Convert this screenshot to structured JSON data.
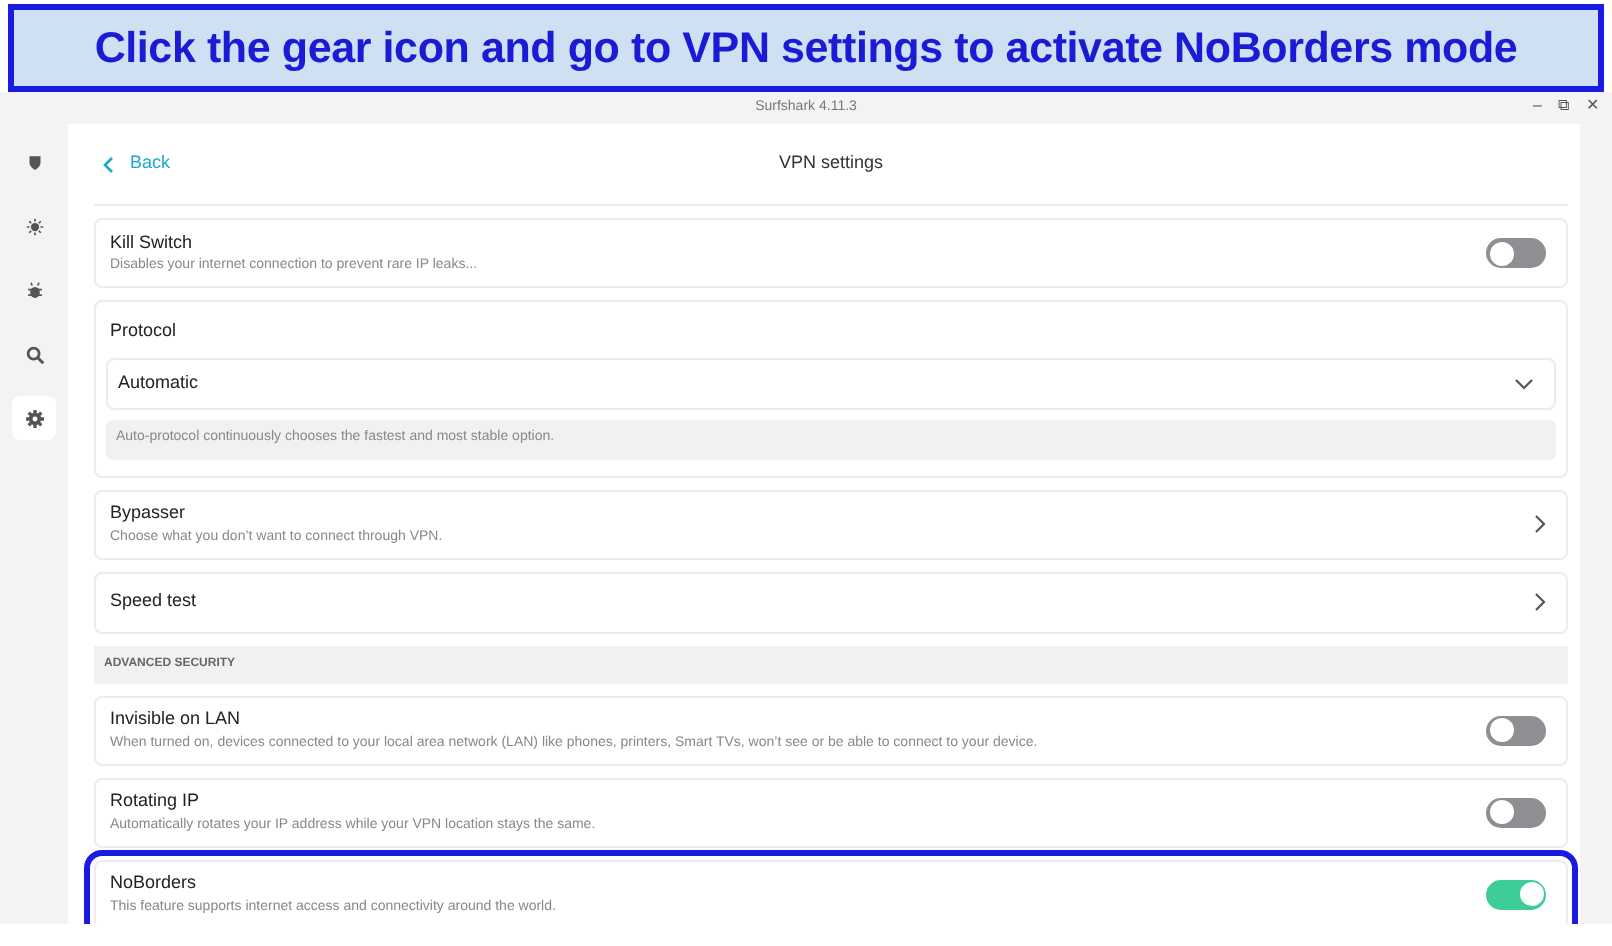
{
  "banner": {
    "text": "Click the gear icon and go to VPN settings to activate NoBorders mode"
  },
  "window": {
    "title": "Surfshark 4.11.3",
    "controls": [
      "–",
      "⧉",
      "✕"
    ]
  },
  "sidebar": {
    "items": [
      {
        "selected": false
      },
      {
        "selected": false
      },
      {
        "selected": false
      },
      {
        "selected": false
      },
      {
        "selected": true
      }
    ]
  },
  "header": {
    "back": "Back",
    "title": "VPN settings"
  },
  "settings": [
    {
      "kind": "toggle",
      "title": "Kill Switch",
      "description": "Disables your internet connection to prevent rare IP leaks...",
      "on": false,
      "highlighted": false
    },
    {
      "kind": "select",
      "title": "Protocol",
      "value": "Automatic",
      "note": "Auto-protocol continuously chooses the fastest and most stable option."
    },
    {
      "kind": "link",
      "title": "Bypasser",
      "description": "Choose what you don’t want to connect through VPN."
    },
    {
      "kind": "link",
      "title": "Speed test"
    },
    {
      "kind": "section",
      "title": "ADVANCED SECURITY"
    },
    {
      "kind": "toggle",
      "title": "Invisible on LAN",
      "description": "When turned on, devices connected to your local area network (LAN) like phones, printers, Smart TVs, won’t see or be able to connect to your device.",
      "on": false,
      "highlighted": false
    },
    {
      "kind": "toggle",
      "title": "Rotating IP",
      "description": "Automatically rotates your IP address while your VPN location stays the same.",
      "on": false,
      "highlighted": false
    },
    {
      "kind": "toggle",
      "title": "NoBorders",
      "description": "This feature supports internet access and connectivity around the world.",
      "on": true,
      "highlighted": true
    }
  ]
}
